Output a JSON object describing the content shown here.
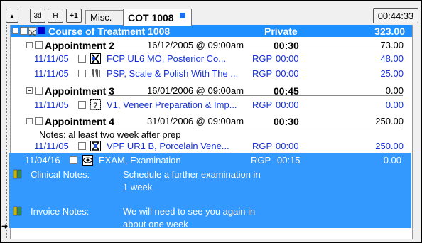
{
  "toolbar": {
    "btn_up": "▲",
    "btn_3d": "3d",
    "btn_h": "H",
    "btn_plus1": "+1",
    "tab_misc": "Misc.",
    "tab_cot": "COT 1008",
    "timer": "00:44:33"
  },
  "course": {
    "title": "Course of Treatment 1008",
    "type": "Private",
    "total": "323.00"
  },
  "appointments": [
    {
      "label": "Appointment 2",
      "date": "16/12/2005 @ 09:00am",
      "dur": "00:30",
      "total": "73.00",
      "items": [
        {
          "date": "11/11/05",
          "desc": "FCP  UL6  MO, Posterior Co...",
          "prov": "RGP",
          "time": "00:00",
          "price": "48.00"
        },
        {
          "date": "11/11/05",
          "desc": "PSP, Scale & Polish With The ...",
          "prov": "RGP",
          "time": "00:00",
          "price": "25.00"
        }
      ]
    },
    {
      "label": "Appointment 3",
      "date": "16/01/2006 @ 09:00am",
      "dur": "00:45",
      "total": "0.00",
      "items": [
        {
          "date": "11/11/05",
          "desc": "V1, Veneer Preparation & Imp...",
          "prov": "RGP",
          "time": "00:00",
          "price": "0.00"
        }
      ]
    },
    {
      "label": "Appointment 4",
      "date": "31/01/2006 @ 09:00am",
      "dur": "00:30",
      "total": "250.00",
      "notes": "Notes: al least two week after prep",
      "items": [
        {
          "date": "11/11/05",
          "desc": "VPF  UR1  B, Porcelain Vene...",
          "prov": "RGP",
          "time": "00:00",
          "price": "250.00"
        }
      ]
    }
  ],
  "exam": {
    "date": "11/04/16",
    "desc": "EXAM, Examination",
    "prov": "RGP",
    "time": "00:15",
    "price": "0.00",
    "clinical_label": "Clinical Notes:",
    "clinical_line1": "Schedule a further examination in",
    "clinical_line2": "1 week",
    "invoice_label": "Invoice Notes:",
    "invoice_line1": "We will need to see you again in",
    "invoice_line2": "about one week"
  }
}
